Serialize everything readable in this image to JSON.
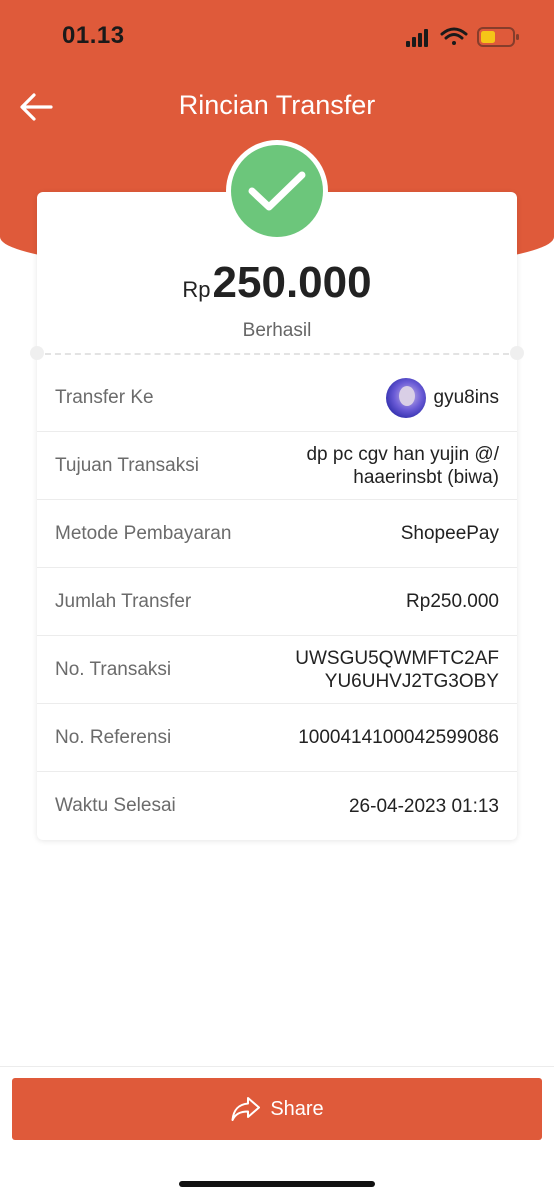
{
  "status_bar": {
    "time": "01.13"
  },
  "nav": {
    "title": "Rincian Transfer",
    "back_icon": "arrow-left-icon"
  },
  "summary": {
    "currency": "Rp",
    "amount": "250.000",
    "status": "Berhasil",
    "status_icon": "check-icon"
  },
  "details": {
    "transfer_to": {
      "label": "Transfer Ke",
      "value": "gyu8ins"
    },
    "purpose": {
      "label": "Tujuan Transaksi",
      "value_line1": "dp pc cgv han yujin @/",
      "value_line2": "haaerinsbt (biwa)"
    },
    "payment_method": {
      "label": "Metode Pembayaran",
      "value": "ShopeePay"
    },
    "transfer_amount": {
      "label": "Jumlah Transfer",
      "value": "Rp250.000"
    },
    "transaction_no": {
      "label": "No. Transaksi",
      "value_line1": "UWSGU5QWMFTC2AF",
      "value_line2": "YU6UHVJ2TG3OBY"
    },
    "reference_no": {
      "label": "No. Referensi",
      "value": "1000414100042599086"
    },
    "completed_time": {
      "label": "Waktu Selesai",
      "value": "26-04-2023 01:13"
    }
  },
  "share": {
    "label": "Share",
    "icon": "share-icon"
  },
  "colors": {
    "brand": "#df5a3a",
    "success": "#6cc67b",
    "battery": "#f5c518"
  }
}
